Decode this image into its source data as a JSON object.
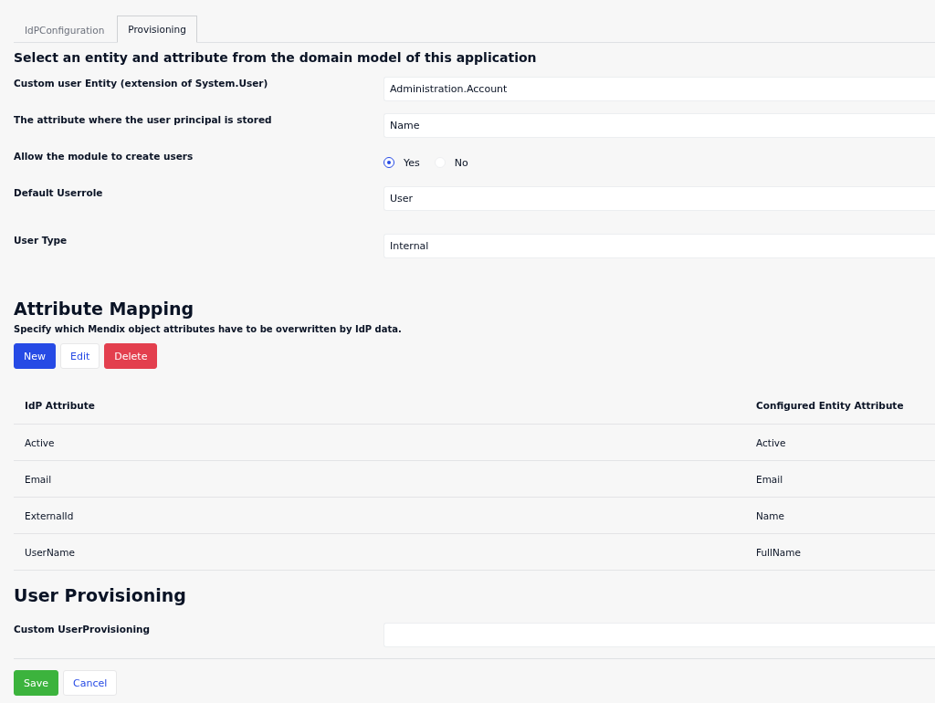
{
  "tabs": [
    {
      "label": "IdPConfiguration",
      "selected": false
    },
    {
      "label": "Provisioning",
      "selected": true
    }
  ],
  "form": {
    "title": "Select an entity and attribute from the domain model of this application",
    "fields": [
      {
        "kind": "text",
        "label": "Custom user Entity (extension of System.User)",
        "value": "Administration.Account"
      },
      {
        "kind": "text",
        "label": "The attribute where the user principal is stored",
        "value": "Name"
      },
      {
        "kind": "radio",
        "label": "Allow the module to create users",
        "options": [
          {
            "label": "Yes",
            "selected": true
          },
          {
            "label": "No",
            "selected": false
          }
        ]
      },
      {
        "kind": "text",
        "label": "Default Userrole",
        "value": "User"
      },
      {
        "kind": "text",
        "label": "User Type",
        "value": "Internal"
      }
    ]
  },
  "attribute_mapping": {
    "title": "Attribute Mapping",
    "description": "Specify which Mendix object attributes have to be overwritten by IdP data.",
    "buttons": [
      {
        "label": "New",
        "kind": "primary"
      },
      {
        "label": "Edit",
        "kind": "default"
      },
      {
        "label": "Delete",
        "kind": "danger"
      }
    ],
    "table": {
      "columns": [
        "IdP Attribute",
        "Configured Entity Attribute"
      ],
      "rows": [
        [
          "Active",
          "Active"
        ],
        [
          "Email",
          "Email"
        ],
        [
          "ExternalId",
          "Name"
        ],
        [
          "UserName",
          "FullName"
        ]
      ]
    }
  },
  "user_provisioning": {
    "title": "User Provisioning",
    "fields": [
      {
        "kind": "text",
        "label": "Custom UserProvisioning"
      }
    ]
  },
  "footer_buttons": [
    {
      "label": "Save",
      "kind": "success"
    },
    {
      "label": "Cancel",
      "kind": "default"
    }
  ]
}
